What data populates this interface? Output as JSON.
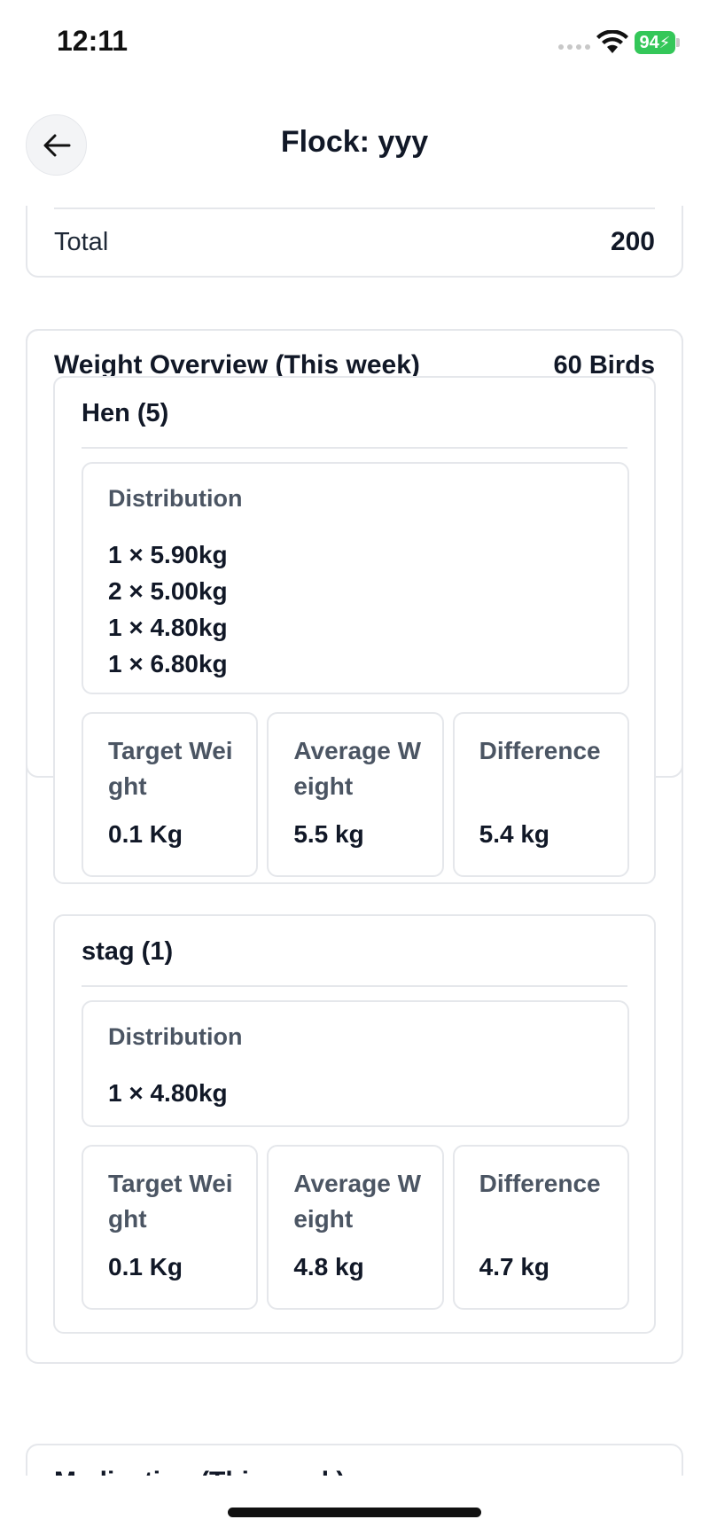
{
  "status_bar": {
    "time": "12:11",
    "battery": "94"
  },
  "header": {
    "title": "Flock: yyy"
  },
  "summary": {
    "total_label": "Total",
    "total_value": "200"
  },
  "weight_overview": {
    "title": "Weight Overview (This week)",
    "bird_count": "60 Birds",
    "groups": [
      {
        "title": "Hen (5)",
        "distribution_label": "Distribution",
        "distribution": [
          "1 × 5.90kg",
          "2 × 5.00kg",
          "1 × 4.80kg",
          "1 × 6.80kg"
        ],
        "stats": [
          {
            "label": "Target Weight",
            "value": "0.1 Kg"
          },
          {
            "label": "Average Weight",
            "value": "5.5 kg"
          },
          {
            "label": "Difference",
            "value": "5.4 kg"
          }
        ]
      },
      {
        "title": "stag (1)",
        "distribution_label": "Distribution",
        "distribution": [
          "1 × 4.80kg"
        ],
        "stats": [
          {
            "label": "Target Weight",
            "value": "0.1 Kg"
          },
          {
            "label": "Average Weight",
            "value": "4.8 kg"
          },
          {
            "label": "Difference",
            "value": "4.7 kg"
          }
        ]
      }
    ]
  },
  "medication": {
    "title": "Medication (This week)"
  }
}
